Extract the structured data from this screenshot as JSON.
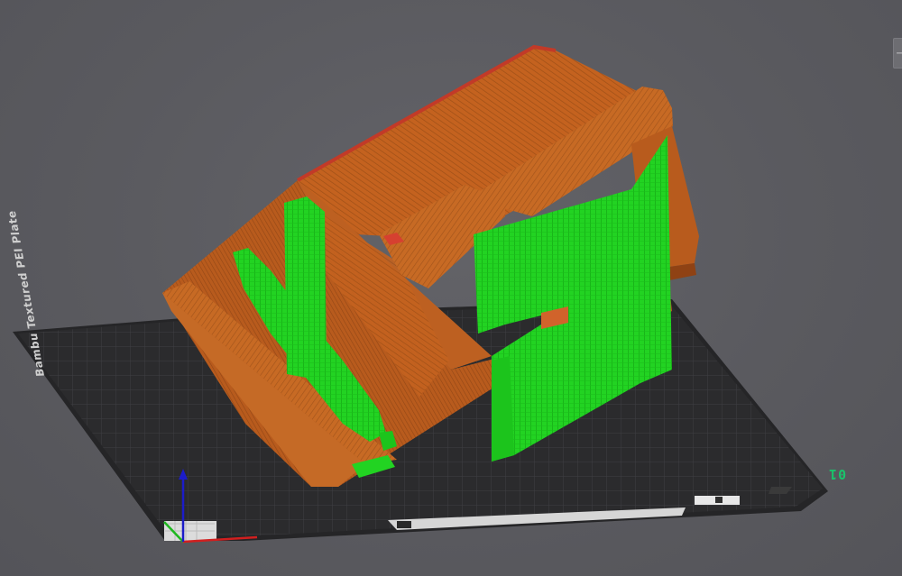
{
  "viewport": {
    "plate_number": "01",
    "bed_label": "Bambu Textured PEI Plate",
    "right_tab_glyph": "−"
  },
  "colors": {
    "background": "#5b5b60",
    "bed_surface": "#2a2a2c",
    "bed_grid": "#414144",
    "model_wall": "#c4621f",
    "model_wall_dark": "#a8521a",
    "model_top_edge": "#c23a28",
    "support": "#22d322",
    "support_dark": "#16a816",
    "plate_number": "#19c46b",
    "axis_x": "#d11f1f",
    "axis_y": "#1fb81f",
    "axis_z": "#1c1cc9"
  },
  "icons": [
    "axis-gizmo-icon",
    "plate-settings-icon",
    "plate-lock-icon"
  ]
}
